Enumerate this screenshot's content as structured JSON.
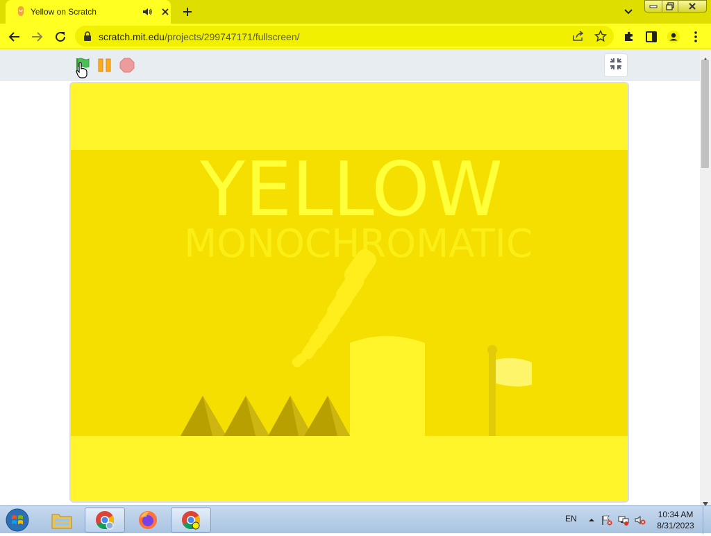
{
  "browser": {
    "tab_title": "Yellow on Scratch",
    "url_host": "scratch.mit.edu",
    "url_path": "/projects/299747171/fullscreen/"
  },
  "icons": {
    "favicon": "scratch-cat-icon",
    "audio": "speaker-icon",
    "close": "close-icon",
    "new_tab": "plus-icon",
    "back": "back-arrow-icon",
    "forward": "forward-arrow-icon",
    "reload": "reload-icon",
    "lock": "lock-icon",
    "share": "share-icon",
    "bookmark": "star-icon",
    "extensions": "puzzle-icon",
    "side_panel": "side-panel-icon",
    "profile": "profile-icon",
    "menu": "kebab-menu-icon",
    "green_flag": "green-flag-icon",
    "pause": "pause-icon",
    "stop": "stop-icon",
    "unfullscreen": "unfullscreen-icon"
  },
  "stage": {
    "title": "YELLOW",
    "subtitle": "MONOCHROMATIC"
  },
  "taskbar": {
    "language": "EN",
    "time": "10:34 AM",
    "date": "8/31/2023"
  },
  "colors": {
    "chrome_frame": "#dede00",
    "chrome_toolbar": "#ffff21",
    "stage_bg": "#fff52a",
    "stage_band": "#f4df00"
  }
}
